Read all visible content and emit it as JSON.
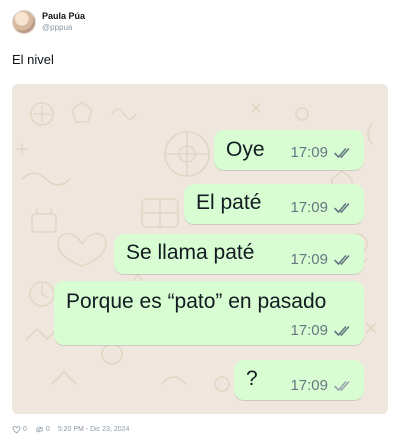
{
  "user": {
    "display_name": "Paula Púa",
    "handle": "@pppua"
  },
  "tweet": {
    "text": "El nivel"
  },
  "messages": [
    {
      "text": "Oye",
      "time": "17:09",
      "status": "read"
    },
    {
      "text": "El paté",
      "time": "17:09",
      "status": "read"
    },
    {
      "text": "Se llama paté",
      "time": "17:09",
      "status": "read"
    },
    {
      "text": "Porque es “pato” en pasado",
      "time": "17:09",
      "status": "read"
    },
    {
      "text": "?",
      "time": "17:09",
      "status": "delivered"
    }
  ],
  "footer": {
    "likes": "0",
    "retweets": "0",
    "timestamp": "5:20 PM - Dic 23, 2024"
  },
  "colors": {
    "bubble": "#d9fdd3",
    "chat_background": "#efe7dd",
    "tick_read": "#667781",
    "tick_delivered": "#9aa5ad"
  }
}
